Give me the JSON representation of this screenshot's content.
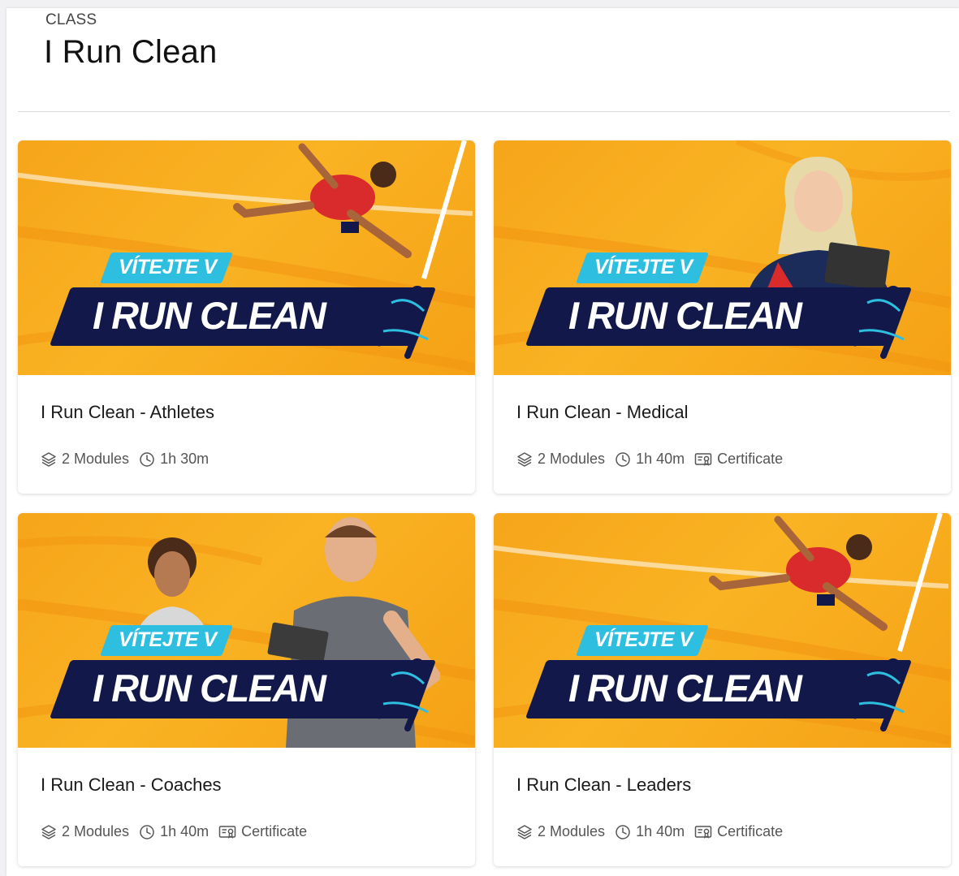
{
  "header": {
    "eyebrow": "CLASS",
    "title": "I Run Clean"
  },
  "banner_text": {
    "welcome": "VÍTEJTE V",
    "logo": "I RUN CLEAN"
  },
  "colors": {
    "banner_orange": "#f9b323",
    "badge_cyan": "#2ebfe0",
    "logo_navy": "#12184a"
  },
  "cards": [
    {
      "title": "I Run Clean - Athletes",
      "modules": "2 Modules",
      "duration": "1h 30m",
      "certificate": "",
      "image": "sprinter-athlete"
    },
    {
      "title": "I Run Clean - Medical",
      "modules": "2 Modules",
      "duration": "1h 40m",
      "certificate": "Certificate",
      "image": "woman-with-clipboard"
    },
    {
      "title": "I Run Clean - Coaches",
      "modules": "2 Modules",
      "duration": "1h 40m",
      "certificate": "Certificate",
      "image": "woman-and-man-with-tablet"
    },
    {
      "title": "I Run Clean - Leaders",
      "modules": "2 Modules",
      "duration": "1h 40m",
      "certificate": "Certificate",
      "image": "sprinter-athlete"
    }
  ]
}
